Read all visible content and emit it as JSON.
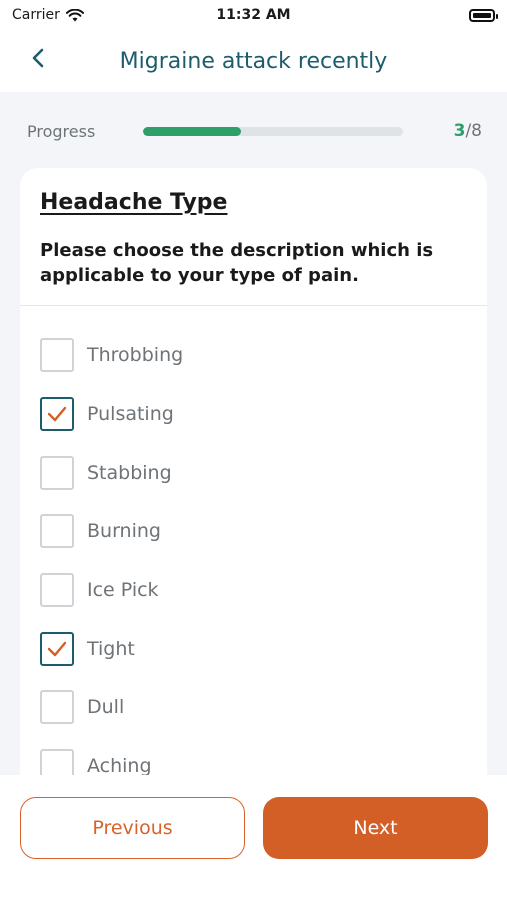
{
  "status_bar": {
    "carrier": "Carrier",
    "time": "11:32 AM"
  },
  "header": {
    "title": "Migraine attack recently"
  },
  "progress": {
    "label": "Progress",
    "current": "3",
    "total": "/8",
    "fraction": 0.375
  },
  "card": {
    "title": "Headache Type",
    "question": "Please choose the description which is applicable to your type of pain.",
    "options": [
      {
        "label": "Throbbing",
        "checked": false
      },
      {
        "label": "Pulsating",
        "checked": true
      },
      {
        "label": "Stabbing",
        "checked": false
      },
      {
        "label": "Burning",
        "checked": false
      },
      {
        "label": "Ice Pick",
        "checked": false
      },
      {
        "label": "Tight",
        "checked": true
      },
      {
        "label": "Dull",
        "checked": false
      },
      {
        "label": "Aching",
        "checked": false
      }
    ]
  },
  "footer": {
    "previous_label": "Previous",
    "next_label": "Next"
  },
  "colors": {
    "accent": "#d45f26",
    "progress": "#2e9e6b",
    "title": "#1d5c6b",
    "checkbox_checked_border": "#1d5c6b"
  }
}
